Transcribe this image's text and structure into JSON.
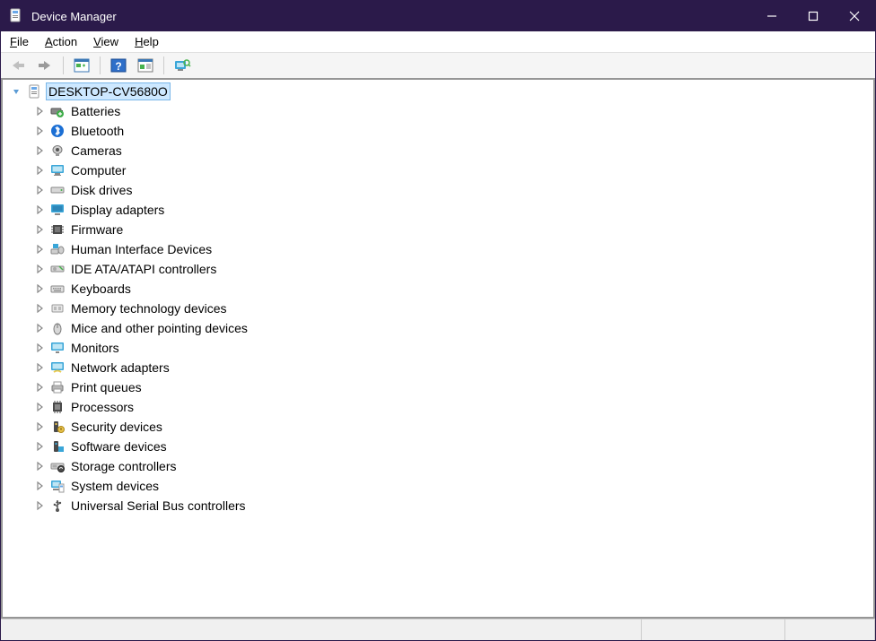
{
  "window": {
    "title": "Device Manager"
  },
  "menu": {
    "file": "File",
    "action": "Action",
    "view": "View",
    "help": "Help"
  },
  "toolbar": {
    "back": "back",
    "forward": "forward",
    "show_hide": "show-hide-tree",
    "help_btn": "help",
    "properties_btn": "properties-sheet",
    "scan": "scan-hardware"
  },
  "tree": {
    "root": {
      "label": "DESKTOP-CV5680O",
      "expanded": true
    },
    "items": [
      {
        "label": "Batteries",
        "icon": "battery"
      },
      {
        "label": "Bluetooth",
        "icon": "bluetooth"
      },
      {
        "label": "Cameras",
        "icon": "camera"
      },
      {
        "label": "Computer",
        "icon": "monitor"
      },
      {
        "label": "Disk drives",
        "icon": "drive"
      },
      {
        "label": "Display adapters",
        "icon": "display"
      },
      {
        "label": "Firmware",
        "icon": "chip"
      },
      {
        "label": "Human Interface Devices",
        "icon": "hid"
      },
      {
        "label": "IDE ATA/ATAPI controllers",
        "icon": "ide"
      },
      {
        "label": "Keyboards",
        "icon": "keyboard"
      },
      {
        "label": "Memory technology devices",
        "icon": "memory"
      },
      {
        "label": "Mice and other pointing devices",
        "icon": "mouse"
      },
      {
        "label": "Monitors",
        "icon": "monitor2"
      },
      {
        "label": "Network adapters",
        "icon": "network"
      },
      {
        "label": "Print queues",
        "icon": "printer"
      },
      {
        "label": "Processors",
        "icon": "cpu"
      },
      {
        "label": "Security devices",
        "icon": "security"
      },
      {
        "label": "Software devices",
        "icon": "software"
      },
      {
        "label": "Storage controllers",
        "icon": "storage"
      },
      {
        "label": "System devices",
        "icon": "system"
      },
      {
        "label": "Universal Serial Bus controllers",
        "icon": "usb"
      }
    ]
  }
}
